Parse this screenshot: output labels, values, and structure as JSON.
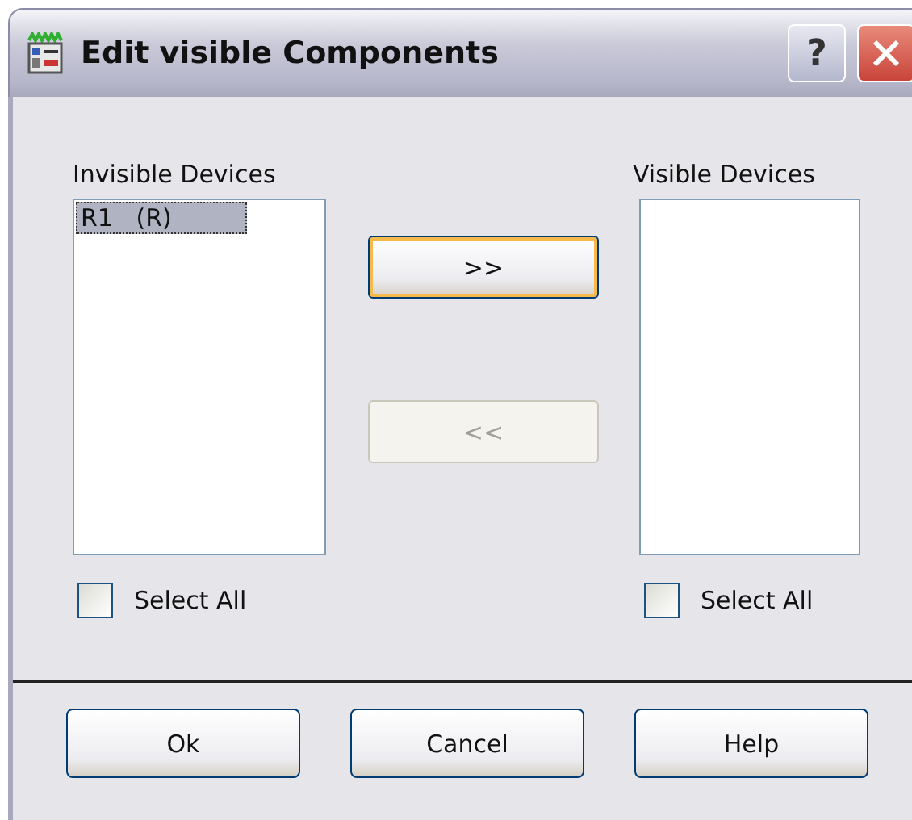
{
  "window": {
    "title": "Edit visible Components",
    "help_button": "?"
  },
  "invisible_devices": {
    "label": "Invisible Devices",
    "items": [
      {
        "text": "R1   (R)",
        "selected": true
      }
    ],
    "select_all": {
      "label": "Select All",
      "checked": false
    }
  },
  "move_buttons": [
    {
      "label": ">>",
      "disabled": false,
      "default": true
    },
    {
      "label": "<<",
      "disabled": true,
      "default": false
    }
  ],
  "visible_devices": {
    "label": "Visible Devices",
    "select_all": {
      "label": "Select All",
      "checked": false
    }
  },
  "buttons": [
    {
      "label": "Ok"
    },
    {
      "label": "Cancel"
    },
    {
      "label": "Help"
    }
  ]
}
